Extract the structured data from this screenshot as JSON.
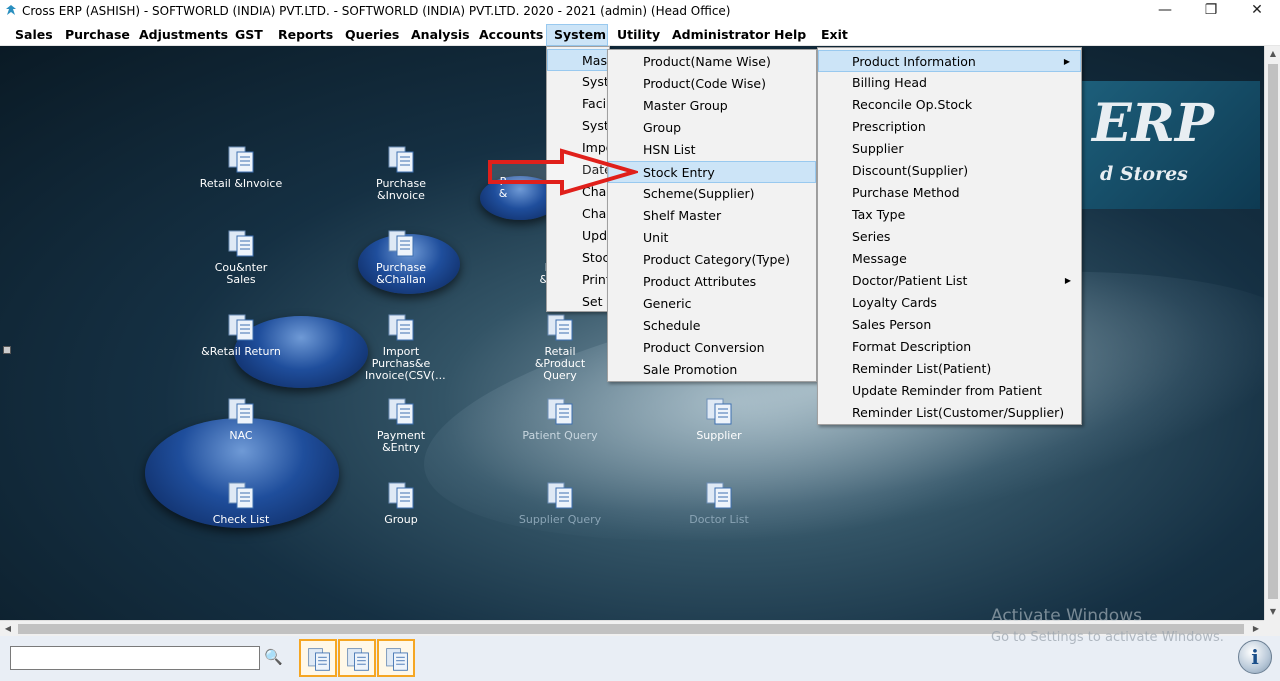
{
  "window": {
    "title": "Cross ERP (ASHISH) - SOFTWORLD (INDIA) PVT.LTD. - SOFTWORLD (INDIA) PVT.LTD.  2020 - 2021 (admin) (Head Office)",
    "minimize_icon": "minimize-icon",
    "maximize_icon": "restore-icon",
    "close_icon": "close-icon"
  },
  "menubar": [
    "Sales",
    "Purchase",
    "Adjustments",
    "GST",
    "Reports",
    "Queries",
    "Analysis",
    "Accounts",
    "System",
    "Utility",
    "Administrator",
    "Help",
    "Exit"
  ],
  "active_menu": "System",
  "system_menu": [
    "Mast",
    "Syste",
    "Facil",
    "Syste",
    "Impo",
    "Date",
    "Chan",
    "Chan",
    "Upda",
    "Stock",
    "Print",
    "Set C"
  ],
  "master_menu": [
    "Product(Name Wise)",
    "Product(Code Wise)",
    "Master Group",
    "Group",
    "HSN List",
    "Stock Entry",
    "Scheme(Supplier)",
    "Shelf Master",
    "Unit",
    "Product Category(Type)",
    "Product Attributes",
    "Generic",
    "Schedule",
    "Product Conversion",
    "Sale Promotion"
  ],
  "master_menu_highlighted": "Stock Entry",
  "product_info_menu": [
    "Product Information",
    "Billing Head",
    "Reconcile Op.Stock",
    "Prescription",
    "Supplier",
    "Discount(Supplier)",
    "Purchase Method",
    "Tax Type",
    "Series",
    "Message",
    "Doctor/Patient List",
    "Loyalty Cards",
    "Sales Person",
    "Format Description",
    "Reminder List(Patient)",
    "Update Reminder from Patient",
    "Reminder List(Customer/Supplier)"
  ],
  "product_info_highlighted": "Product Information",
  "logo": {
    "big": "ERP",
    "small": "d Stores"
  },
  "shortcuts": {
    "retail_invoice": "Retail &Invoice",
    "purchase_invoice": "Purchase &Invoice",
    "counter_sales": "Cou&nter Sales",
    "purchase_challan": "Purchase &Challan",
    "retail_return": "&Retail Return",
    "import_purchase": "Import Purchas&e Invoice(CSV(...",
    "retail_product_query": "Retail &Product Query",
    "nac": "NAC",
    "payment_entry": "Payment &Entry",
    "patient_query": "Patient Query",
    "supplier": "Supplier",
    "check_list": "Check List",
    "group": "Group",
    "supplier_query": "Supplier Query",
    "doctor_list": "Doctor List",
    "partial_p1": "P",
    "partial_p1b": "&",
    "partial_p2": "P",
    "partial_p2b": "&D"
  },
  "search": {
    "value": "",
    "button_icon": "magnifier-icon"
  },
  "watermark": {
    "line1": "Activate Windows",
    "line2": "Go to Settings to activate Windows."
  },
  "colors": {
    "menu_highlight": "#cce4f7",
    "arrow": "#e0201b",
    "quick_border": "#f5a623"
  }
}
